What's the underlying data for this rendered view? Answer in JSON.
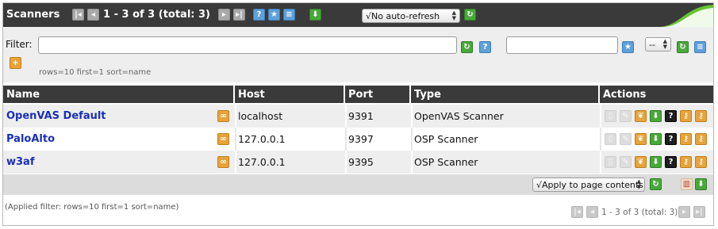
{
  "header": {
    "title": "Scanners",
    "count_text": "1 - 3 of 3 (total: 3)",
    "refresh_select": "√No auto-refresh"
  },
  "filter": {
    "label": "Filter:",
    "value": "",
    "note": "rows=10 first=1 sort=name",
    "saved_filter_value": "",
    "saved_select": "--"
  },
  "table": {
    "headers": [
      "Name",
      "Host",
      "Port",
      "Type",
      "Actions"
    ],
    "rows": [
      {
        "name": "OpenVAS Default",
        "host": "localhost",
        "port": "9391",
        "type": "OpenVAS Scanner"
      },
      {
        "name": "PaloAlto",
        "host": "127.0.0.1",
        "port": "9397",
        "type": "OSP Scanner"
      },
      {
        "name": "w3af",
        "host": "127.0.0.1",
        "port": "9395",
        "type": "OSP Scanner"
      }
    ]
  },
  "footer": {
    "apply_select": "√Apply to page contents",
    "applied_filter": "(Applied filter: rows=10 first=1 sort=name)",
    "count_text": "1 - 3 of 3 (total: 3)"
  },
  "colors": {
    "header_bg": "#3a3a3a",
    "accent_green": "#66c430",
    "link_blue": "#1a2fb7",
    "row_alt": "#eeeeee"
  }
}
